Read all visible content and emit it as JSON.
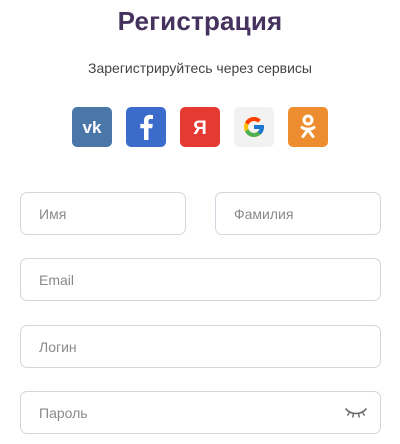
{
  "header": {
    "title": "Регистрация",
    "subtitle": "Зарегистрируйтесь через сервисы"
  },
  "social": [
    {
      "service": "vk",
      "icon": "vk-icon",
      "color": "#4a76a8"
    },
    {
      "service": "facebook",
      "icon": "facebook-icon",
      "color": "#3b6ccb"
    },
    {
      "service": "yandex",
      "icon": "yandex-icon",
      "color": "#e53a31"
    },
    {
      "service": "google",
      "icon": "google-icon",
      "color": "#f2f2f2"
    },
    {
      "service": "odnoklassniki",
      "icon": "odnoklassniki-icon",
      "color": "#ee8d30"
    }
  ],
  "form": {
    "first_name": {
      "placeholder": "Имя",
      "value": ""
    },
    "last_name": {
      "placeholder": "Фамилия",
      "value": ""
    },
    "email": {
      "placeholder": "Email",
      "value": ""
    },
    "login": {
      "placeholder": "Логин",
      "value": ""
    },
    "password": {
      "placeholder": "Пароль",
      "value": "",
      "toggle_icon": "eye-closed-icon"
    }
  },
  "colors": {
    "title": "#45325e",
    "input_border": "#d8d4df",
    "placeholder": "#8a8a8a"
  }
}
